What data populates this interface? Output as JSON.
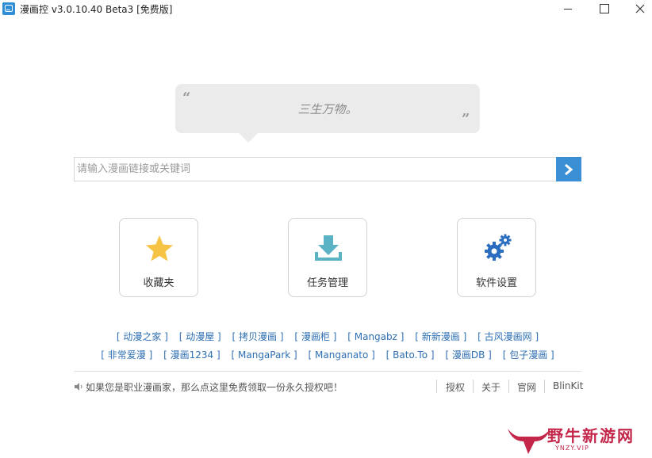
{
  "window": {
    "title": "漫画控 v3.0.10.40 Beta3 [免费版]"
  },
  "quote": {
    "open_mark": "“",
    "close_mark": "”",
    "text": "三生万物。"
  },
  "search": {
    "placeholder": "请输入漫画链接或关键词",
    "value": ""
  },
  "tiles": [
    {
      "label": "收藏夹",
      "icon": "star-icon",
      "color": "#f6c344"
    },
    {
      "label": "任务管理",
      "icon": "download-icon",
      "color": "#5ab3c4"
    },
    {
      "label": "软件设置",
      "icon": "gears-icon",
      "color": "#2a6cbf"
    }
  ],
  "sources": {
    "row1": [
      "动漫之家",
      "动漫屋",
      "拷贝漫画",
      "漫画柜",
      "Mangabz",
      "新新漫画",
      "古风漫画网"
    ],
    "row2": [
      "非常爱漫",
      "漫画1234",
      "MangaPark",
      "Manganato",
      "Bato.To",
      "漫画DB",
      "包子漫画"
    ]
  },
  "footer": {
    "promo": "如果您是职业漫画家，那么点这里免费领取一份永久授权吧！",
    "links": [
      "授权",
      "关于",
      "官网",
      "BlinKit"
    ]
  },
  "watermark": {
    "text": "野牛新游网",
    "sub": "YNZY.VIP"
  },
  "colors": {
    "accent": "#3a8fd4",
    "link": "#2f6fb3",
    "watermark": "#c4264a"
  }
}
